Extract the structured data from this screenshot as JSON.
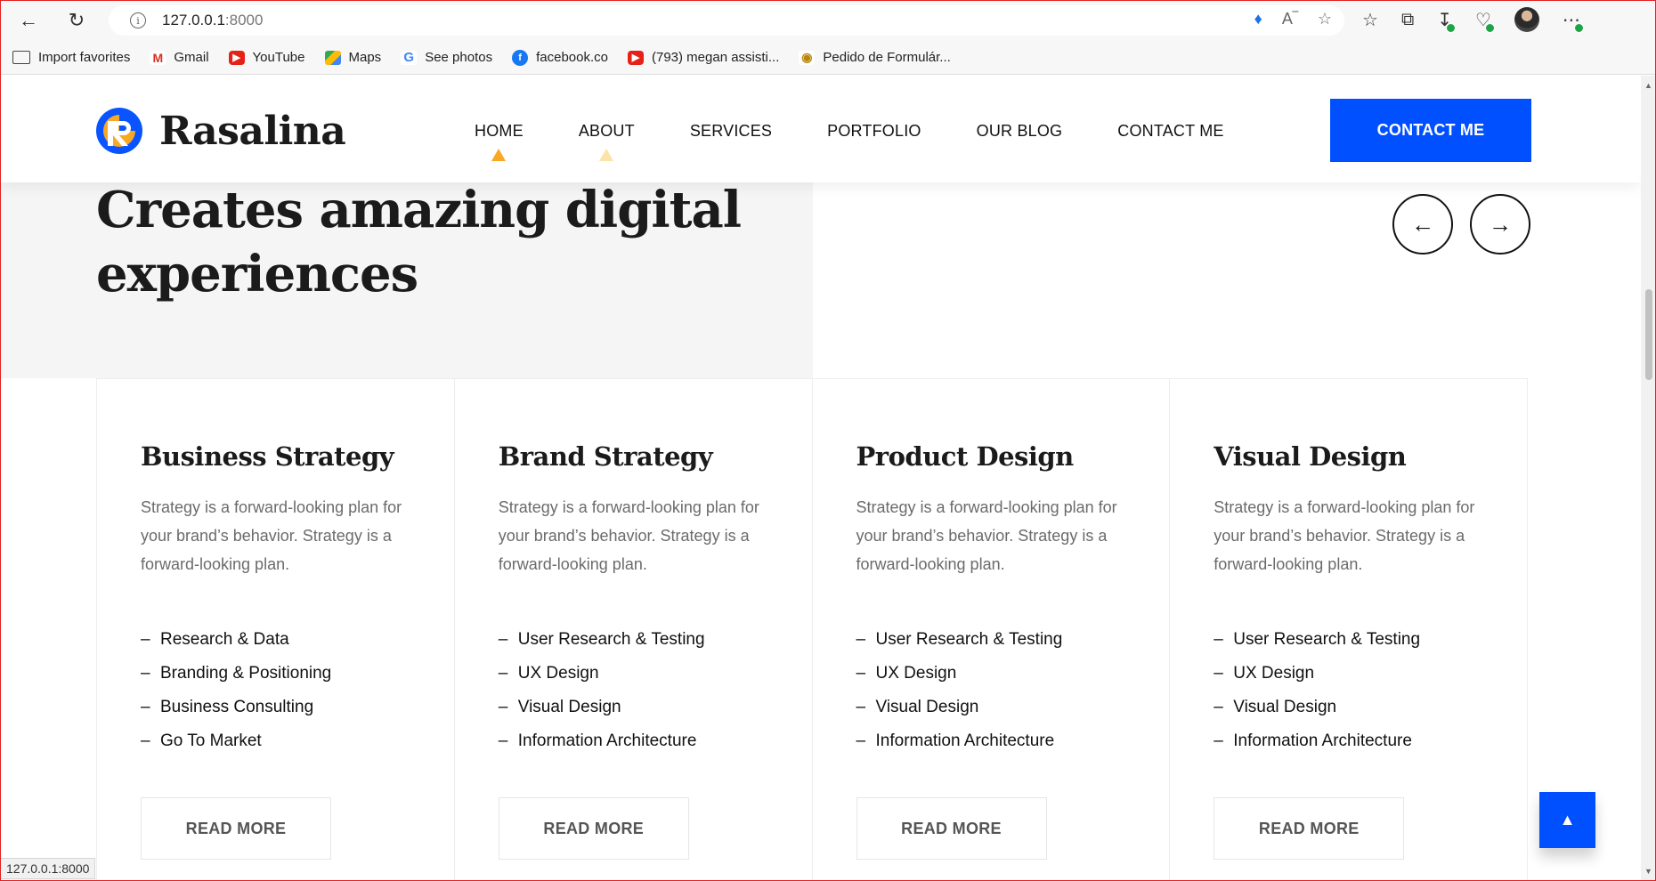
{
  "browser": {
    "url_host": "127.0.0.1",
    "url_port": ":8000",
    "bookmarks": [
      {
        "label": "Import favorites",
        "icon": "folder-icon"
      },
      {
        "label": "Gmail",
        "icon": "gmail-icon"
      },
      {
        "label": "YouTube",
        "icon": "youtube-icon"
      },
      {
        "label": "Maps",
        "icon": "maps-icon"
      },
      {
        "label": "See photos",
        "icon": "google-icon"
      },
      {
        "label": "facebook.co",
        "icon": "facebook-icon"
      },
      {
        "label": "(793) megan assisti...",
        "icon": "youtube-icon"
      },
      {
        "label": "Pedido de Formulár...",
        "icon": "eye-icon"
      }
    ],
    "status_url": "127.0.0.1:8000"
  },
  "header": {
    "logo_text": "Rasalina",
    "menu": [
      "HOME",
      "ABOUT",
      "SERVICES",
      "PORTFOLIO",
      "OUR BLOG",
      "CONTACT ME"
    ],
    "cta_label": "CONTACT ME"
  },
  "hero": {
    "title_line1": "Creates amazing digital",
    "title_line2": "experiences"
  },
  "services": [
    {
      "title": "Business Strategy",
      "description": "Strategy is a forward-looking plan for your brand’s behavior. Strategy is a forward-looking plan.",
      "features": [
        "Research & Data",
        "Branding & Positioning",
        "Business Consulting",
        "Go To Market"
      ],
      "button": "READ MORE"
    },
    {
      "title": "Brand Strategy",
      "description": "Strategy is a forward-looking plan for your brand’s behavior. Strategy is a forward-looking plan.",
      "features": [
        "User Research & Testing",
        "UX Design",
        "Visual Design",
        "Information Architecture"
      ],
      "button": "READ MORE"
    },
    {
      "title": "Product Design",
      "description": "Strategy is a forward-looking plan for your brand’s behavior. Strategy is a forward-looking plan.",
      "features": [
        "User Research & Testing",
        "UX Design",
        "Visual Design",
        "Information Architecture"
      ],
      "button": "READ MORE"
    },
    {
      "title": "Visual Design",
      "description": "Strategy is a forward-looking plan for your brand’s behavior. Strategy is a forward-looking plan.",
      "features": [
        "User Research & Testing",
        "UX Design",
        "Visual Design",
        "Information Architecture"
      ],
      "button": "READ MORE"
    }
  ],
  "colors": {
    "accent": "#0050ff",
    "brand_orange": "#f9a825",
    "brand_blue": "#0a54ff"
  }
}
